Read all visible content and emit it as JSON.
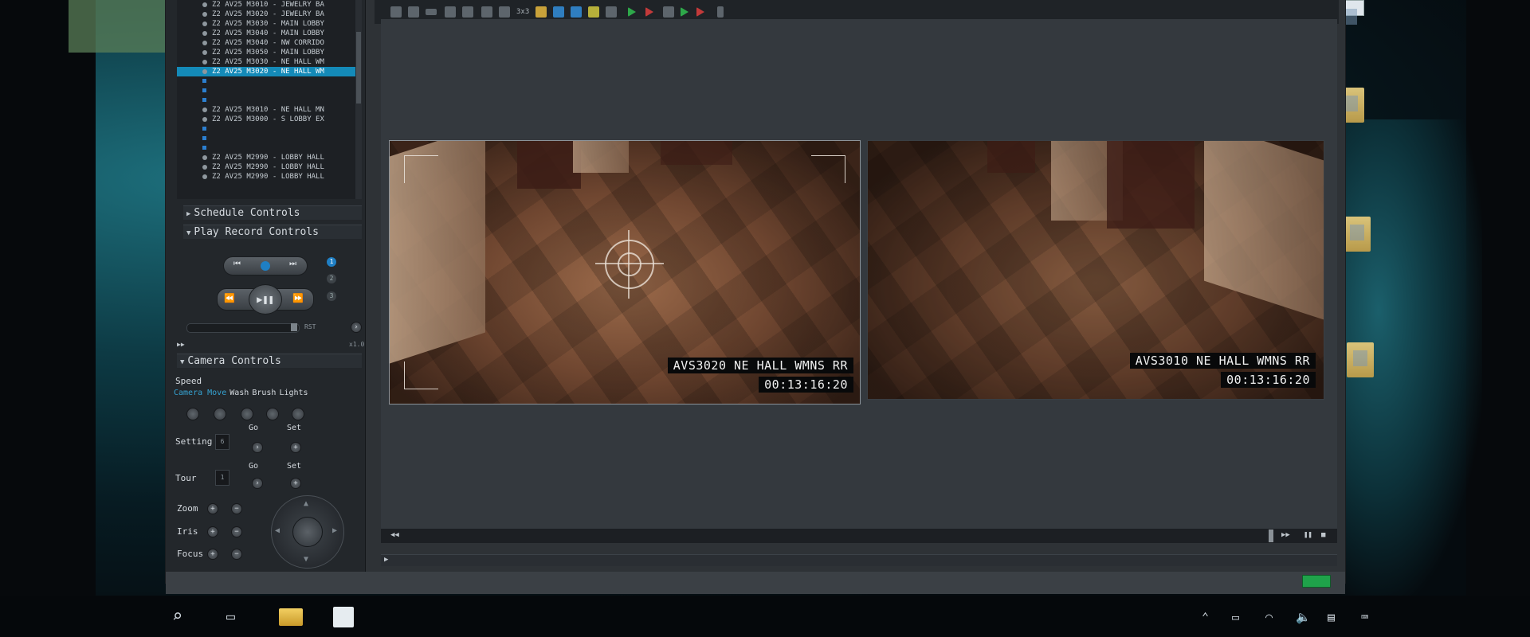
{
  "camera_tree": [
    {
      "label": "Z2 AV25 M3010 - JEWELRY BA",
      "selected": false
    },
    {
      "label": "Z2 AV25 M3020 - JEWELRY BA",
      "selected": false
    },
    {
      "label": "Z2 AV25 M3030 - MAIN LOBBY",
      "selected": false
    },
    {
      "label": "Z2 AV25 M3040 - MAIN LOBBY",
      "selected": false
    },
    {
      "label": "Z2 AV25 M3040 - NW CORRIDO",
      "selected": false
    },
    {
      "label": "Z2 AV25 M3050 - MAIN LOBBY",
      "selected": false
    },
    {
      "label": "Z2 AV25 M3030 - NE HALL WM",
      "selected": false
    },
    {
      "label": "Z2 AV25 M3020 - NE HALL WM",
      "selected": true
    },
    {
      "label": "",
      "selected": false
    },
    {
      "label": "",
      "selected": false
    },
    {
      "label": "",
      "selected": false
    },
    {
      "label": "Z2 AV25 M3010 - NE HALL MN",
      "selected": false
    },
    {
      "label": "Z2 AV25 M3000 - S LOBBY EX",
      "selected": false
    },
    {
      "label": "",
      "selected": false
    },
    {
      "label": "",
      "selected": false
    },
    {
      "label": "",
      "selected": false
    },
    {
      "label": "Z2 AV25 M2990 - LOBBY HALL",
      "selected": false
    },
    {
      "label": "Z2 AV25 M2990 - LOBBY HALL",
      "selected": false
    },
    {
      "label": "Z2 AV25 M2990 - LOBBY HALL",
      "selected": false
    }
  ],
  "sections": {
    "schedule": "Schedule Controls",
    "play_record": "Play Record Controls",
    "camera": "Camera Controls"
  },
  "play_record": {
    "presets": [
      "1",
      "2",
      "3"
    ],
    "rst_label": "RST",
    "speed_value": "x1.0"
  },
  "camera_controls": {
    "speed_label": "Speed",
    "tabs": [
      "Camera Move",
      "Wash",
      "Brush",
      "Lights"
    ],
    "active_tab": "Camera Move",
    "setting_label": "Setting",
    "setting_value": "6",
    "tour_label": "Tour",
    "tour_value": "1",
    "go_label": "Go",
    "set_label": "Set",
    "zoom_label": "Zoom",
    "iris_label": "Iris",
    "focus_label": "Focus"
  },
  "toolbar": {
    "layout_label": "3x3"
  },
  "videos": [
    {
      "camera_name": "AVS3020 NE HALL WMNS RR",
      "timestamp": "00:13:16:20"
    },
    {
      "camera_name": "AVS3010 NE HALL WMNS RR",
      "timestamp": "00:13:16:20"
    }
  ],
  "colors": {
    "selection": "#148ab8",
    "active_tab": "#35a2d1",
    "status_led": "#1fa24a"
  }
}
